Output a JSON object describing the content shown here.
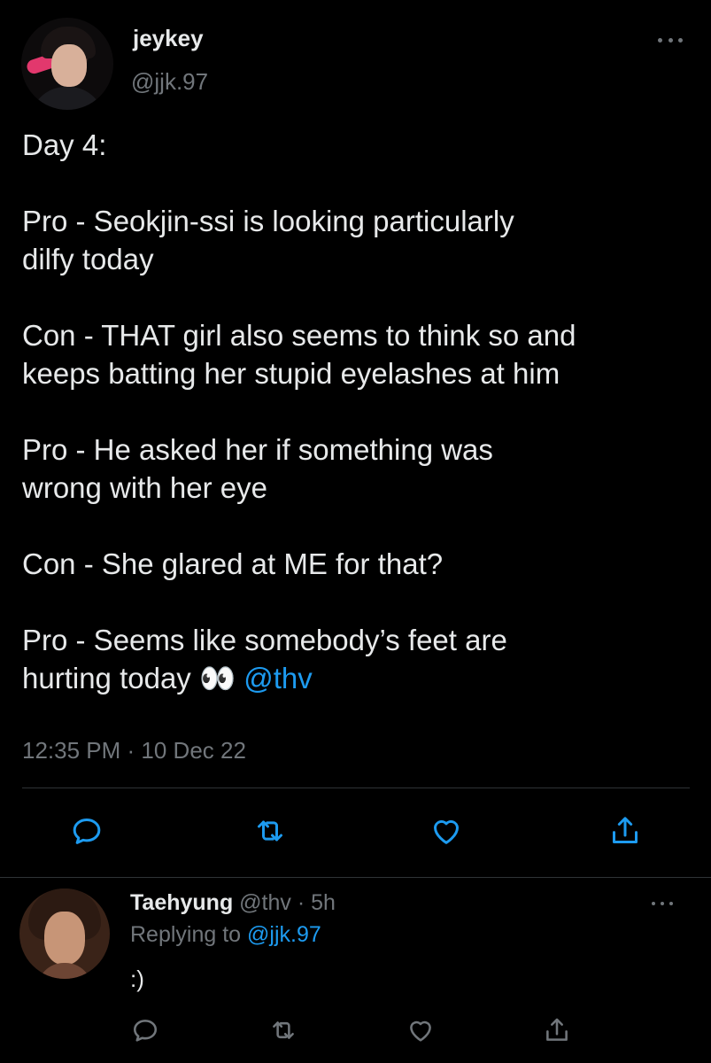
{
  "main_tweet": {
    "author_name": "jeykey",
    "author_handle": "@jjk.97",
    "lines": {
      "l1": "Day 4:",
      "l2": "Pro - Seokjin-ssi is looking particularly",
      "l3": "dilfy today",
      "l4": "Con - THAT girl also seems to think so and",
      "l5": "keeps batting her stupid eyelashes at him",
      "l6": "Pro - He asked her if something was",
      "l7": "wrong with her eye",
      "l8": "Con - She glared at ME for that?",
      "l9": "Pro - Seems like somebody’s feet are",
      "l10": "hurting today",
      "emoji": "👀",
      "mention": "@thv"
    },
    "timestamp": "12:35 PM · 10 Dec 22"
  },
  "reply": {
    "author_name": "Taehyung",
    "author_handle": "@thv",
    "age": "· 5h",
    "replying_prefix": "Replying to",
    "replying_handle": "@jjk.97",
    "text": ":)"
  },
  "icons": {
    "reply": "reply-icon",
    "retweet": "retweet-icon",
    "like": "heart-icon",
    "share": "share-icon",
    "more": "more-icon"
  },
  "colors": {
    "background": "#000000",
    "text": "#e7e9ea",
    "muted": "#71767b",
    "link": "#1d9bf0",
    "divider": "#2f3336"
  }
}
